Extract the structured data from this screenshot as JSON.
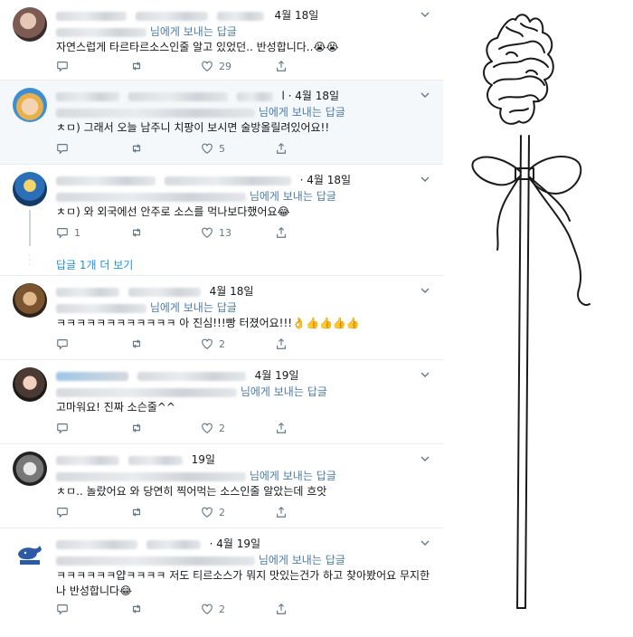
{
  "feed": {
    "reply_label": "님에게 보내는 답글",
    "show_more": "답글 1개 더 보기",
    "tweets": [
      {
        "date": "4월 18일",
        "text": "자연스럽게 타르타르소스인줄 알고 있었던.. 반성합니다..😭😭",
        "replies": "",
        "retweets": "",
        "likes": "29"
      },
      {
        "date": "l · 4월 18일",
        "text": "ㅊㅁ) 그래서 오늘 남주니 치팡이 보시면 술방올릴려있어요!!",
        "replies": "",
        "retweets": "",
        "likes": "5"
      },
      {
        "date": "· 4월 18일",
        "text": "ㅊㅁ) 와 외국에선 안주로 소스를 먹나보다했어요😂",
        "replies": "1",
        "retweets": "",
        "likes": "13"
      },
      {
        "date": "4월 18일",
        "text": "ㅋㅋㅋㅋㅋㅋㅋㅋㅋㅋㅋㅋ 아 진심!!!빵 터졌어요!!!👌👍👍👍👍",
        "replies": "",
        "retweets": "",
        "likes": "2"
      },
      {
        "date": "4월 19일",
        "text": "고마워요! 진짜 소슨줄^^",
        "replies": "",
        "retweets": "",
        "likes": "2"
      },
      {
        "date": "19일",
        "text": "ㅊㅁ.. 놀랐어요 와 당연히 찍어먹는 소스인줄 알았는데 흐앗",
        "replies": "",
        "retweets": "",
        "likes": "2"
      },
      {
        "date": "· 4월 19일",
        "text": "ㅋㅋㅋㅋㅋㅋ얍ㅋㅋㅋㅋ 저도 티르소스가 뭐지 맛있는건가 하고 찾아봤어요 무지한 나 반성합니다😂",
        "replies": "",
        "retweets": "",
        "likes": "2"
      }
    ]
  },
  "colors": {
    "accent": "#1b95e0",
    "muted": "#657786",
    "divider": "#e6ecf0"
  },
  "icons": {
    "reply": "reply-icon",
    "retweet": "retweet-icon",
    "like": "heart-icon",
    "share": "share-icon",
    "menu": "chevron-down-icon"
  }
}
